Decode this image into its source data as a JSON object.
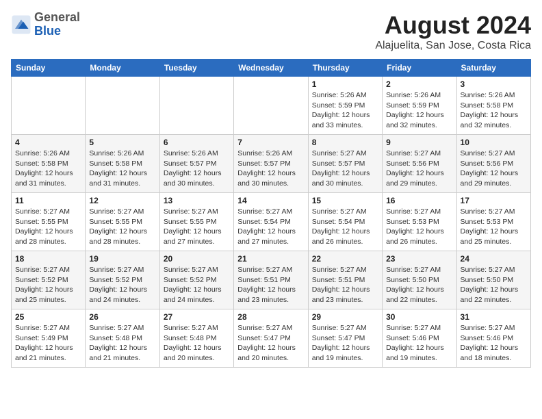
{
  "header": {
    "logo_general": "General",
    "logo_blue": "Blue",
    "month": "August 2024",
    "location": "Alajuelita, San Jose, Costa Rica"
  },
  "days_of_week": [
    "Sunday",
    "Monday",
    "Tuesday",
    "Wednesday",
    "Thursday",
    "Friday",
    "Saturday"
  ],
  "weeks": [
    [
      {
        "day": "",
        "info": ""
      },
      {
        "day": "",
        "info": ""
      },
      {
        "day": "",
        "info": ""
      },
      {
        "day": "",
        "info": ""
      },
      {
        "day": "1",
        "info": "Sunrise: 5:26 AM\nSunset: 5:59 PM\nDaylight: 12 hours\nand 33 minutes."
      },
      {
        "day": "2",
        "info": "Sunrise: 5:26 AM\nSunset: 5:59 PM\nDaylight: 12 hours\nand 32 minutes."
      },
      {
        "day": "3",
        "info": "Sunrise: 5:26 AM\nSunset: 5:58 PM\nDaylight: 12 hours\nand 32 minutes."
      }
    ],
    [
      {
        "day": "4",
        "info": "Sunrise: 5:26 AM\nSunset: 5:58 PM\nDaylight: 12 hours\nand 31 minutes."
      },
      {
        "day": "5",
        "info": "Sunrise: 5:26 AM\nSunset: 5:58 PM\nDaylight: 12 hours\nand 31 minutes."
      },
      {
        "day": "6",
        "info": "Sunrise: 5:26 AM\nSunset: 5:57 PM\nDaylight: 12 hours\nand 30 minutes."
      },
      {
        "day": "7",
        "info": "Sunrise: 5:26 AM\nSunset: 5:57 PM\nDaylight: 12 hours\nand 30 minutes."
      },
      {
        "day": "8",
        "info": "Sunrise: 5:27 AM\nSunset: 5:57 PM\nDaylight: 12 hours\nand 30 minutes."
      },
      {
        "day": "9",
        "info": "Sunrise: 5:27 AM\nSunset: 5:56 PM\nDaylight: 12 hours\nand 29 minutes."
      },
      {
        "day": "10",
        "info": "Sunrise: 5:27 AM\nSunset: 5:56 PM\nDaylight: 12 hours\nand 29 minutes."
      }
    ],
    [
      {
        "day": "11",
        "info": "Sunrise: 5:27 AM\nSunset: 5:55 PM\nDaylight: 12 hours\nand 28 minutes."
      },
      {
        "day": "12",
        "info": "Sunrise: 5:27 AM\nSunset: 5:55 PM\nDaylight: 12 hours\nand 28 minutes."
      },
      {
        "day": "13",
        "info": "Sunrise: 5:27 AM\nSunset: 5:55 PM\nDaylight: 12 hours\nand 27 minutes."
      },
      {
        "day": "14",
        "info": "Sunrise: 5:27 AM\nSunset: 5:54 PM\nDaylight: 12 hours\nand 27 minutes."
      },
      {
        "day": "15",
        "info": "Sunrise: 5:27 AM\nSunset: 5:54 PM\nDaylight: 12 hours\nand 26 minutes."
      },
      {
        "day": "16",
        "info": "Sunrise: 5:27 AM\nSunset: 5:53 PM\nDaylight: 12 hours\nand 26 minutes."
      },
      {
        "day": "17",
        "info": "Sunrise: 5:27 AM\nSunset: 5:53 PM\nDaylight: 12 hours\nand 25 minutes."
      }
    ],
    [
      {
        "day": "18",
        "info": "Sunrise: 5:27 AM\nSunset: 5:52 PM\nDaylight: 12 hours\nand 25 minutes."
      },
      {
        "day": "19",
        "info": "Sunrise: 5:27 AM\nSunset: 5:52 PM\nDaylight: 12 hours\nand 24 minutes."
      },
      {
        "day": "20",
        "info": "Sunrise: 5:27 AM\nSunset: 5:52 PM\nDaylight: 12 hours\nand 24 minutes."
      },
      {
        "day": "21",
        "info": "Sunrise: 5:27 AM\nSunset: 5:51 PM\nDaylight: 12 hours\nand 23 minutes."
      },
      {
        "day": "22",
        "info": "Sunrise: 5:27 AM\nSunset: 5:51 PM\nDaylight: 12 hours\nand 23 minutes."
      },
      {
        "day": "23",
        "info": "Sunrise: 5:27 AM\nSunset: 5:50 PM\nDaylight: 12 hours\nand 22 minutes."
      },
      {
        "day": "24",
        "info": "Sunrise: 5:27 AM\nSunset: 5:50 PM\nDaylight: 12 hours\nand 22 minutes."
      }
    ],
    [
      {
        "day": "25",
        "info": "Sunrise: 5:27 AM\nSunset: 5:49 PM\nDaylight: 12 hours\nand 21 minutes."
      },
      {
        "day": "26",
        "info": "Sunrise: 5:27 AM\nSunset: 5:48 PM\nDaylight: 12 hours\nand 21 minutes."
      },
      {
        "day": "27",
        "info": "Sunrise: 5:27 AM\nSunset: 5:48 PM\nDaylight: 12 hours\nand 20 minutes."
      },
      {
        "day": "28",
        "info": "Sunrise: 5:27 AM\nSunset: 5:47 PM\nDaylight: 12 hours\nand 20 minutes."
      },
      {
        "day": "29",
        "info": "Sunrise: 5:27 AM\nSunset: 5:47 PM\nDaylight: 12 hours\nand 19 minutes."
      },
      {
        "day": "30",
        "info": "Sunrise: 5:27 AM\nSunset: 5:46 PM\nDaylight: 12 hours\nand 19 minutes."
      },
      {
        "day": "31",
        "info": "Sunrise: 5:27 AM\nSunset: 5:46 PM\nDaylight: 12 hours\nand 18 minutes."
      }
    ]
  ]
}
